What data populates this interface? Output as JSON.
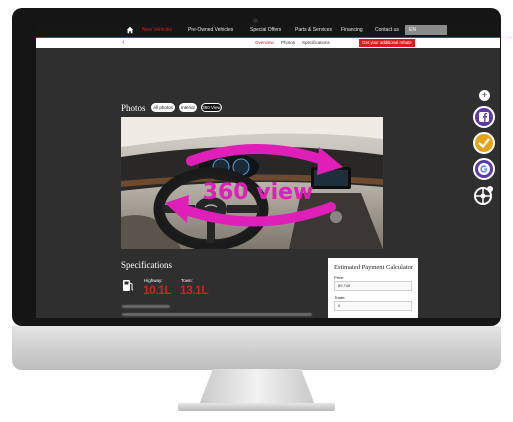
{
  "nav": {
    "items": [
      "New Vehicles",
      "Pre-Owned Vehicles",
      "Special Offers",
      "Parts & Services",
      "Financing",
      "Contact us"
    ],
    "right_label": "EN"
  },
  "subnav": {
    "back": "‹",
    "items": [
      "Overview",
      "Photos",
      "Specifications"
    ],
    "cta": "Get your additional rebate"
  },
  "photos": {
    "title": "Photos",
    "filters": [
      "All photos",
      "Interior",
      "360 View"
    ],
    "overlay_text": "360 view"
  },
  "sidebar": {
    "plus": "+",
    "buttons": [
      {
        "icon": "facebook-icon",
        "color": "#5b3aa5"
      },
      {
        "icon": "check-icon",
        "color": "#e4a419"
      },
      {
        "icon": "google-icon",
        "color": "#5b3aa5"
      },
      {
        "icon": "wheel-settings-icon",
        "color": "#2f2f2f"
      }
    ]
  },
  "specs": {
    "title": "Specifications",
    "highway_label": "Highway:",
    "highway_value": "10.1L",
    "town_label": "Town:",
    "town_value": "13.1L"
  },
  "calculator": {
    "title": "Estimated Payment Calculator",
    "price_label": "Price:",
    "price_value": "89,745",
    "trade_label": "Trade:",
    "trade_value": "0"
  },
  "colors": {
    "accent": "#d81e1e",
    "overlay": "#e01fb8",
    "screen_bg": "#2f2f2f"
  }
}
